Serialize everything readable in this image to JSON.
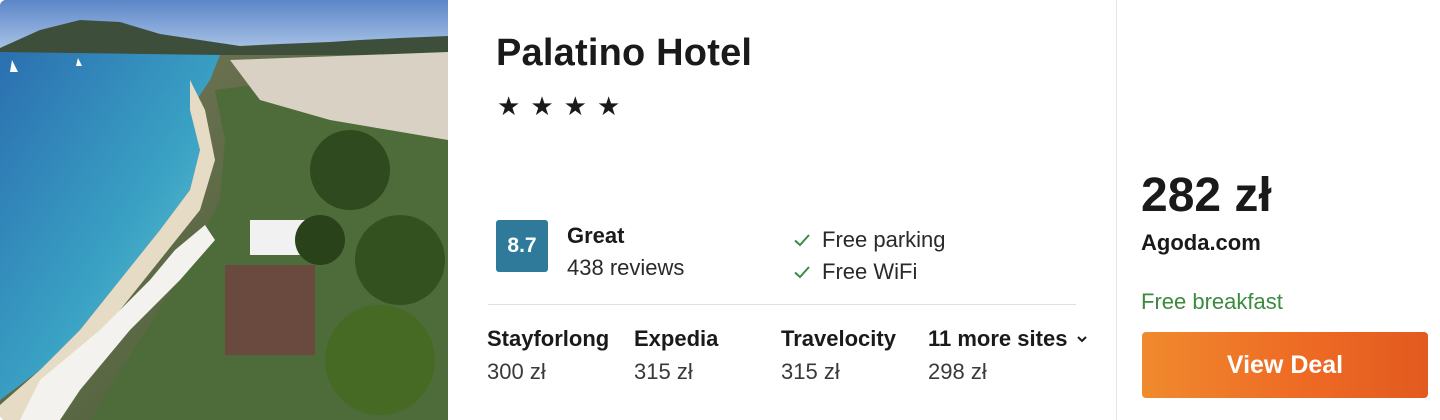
{
  "hotel": {
    "name": "Palatino Hotel",
    "stars": [
      "★",
      "★",
      "★",
      "★"
    ]
  },
  "rating": {
    "score": "8.7",
    "word": "Great",
    "reviews": "438 reviews"
  },
  "amenities": [
    "Free parking",
    "Free WiFi"
  ],
  "other_sites": [
    {
      "name": "Stayforlong",
      "price": "300 zł"
    },
    {
      "name": "Expedia",
      "price": "315 zł"
    },
    {
      "name": "Travelocity",
      "price": "315 zł"
    },
    {
      "name": "11 more sites",
      "price": "298 zł"
    }
  ],
  "deal": {
    "price": "282 zł",
    "provider": "Agoda.com",
    "extra": "Free breakfast",
    "button_label": "View Deal"
  },
  "colors": {
    "rating_badge": "#2f7a9b",
    "check": "#3b8a3e",
    "button": "#ee6b24"
  },
  "icons": {
    "check": "check-icon",
    "chevron": "chevron-down-icon"
  }
}
